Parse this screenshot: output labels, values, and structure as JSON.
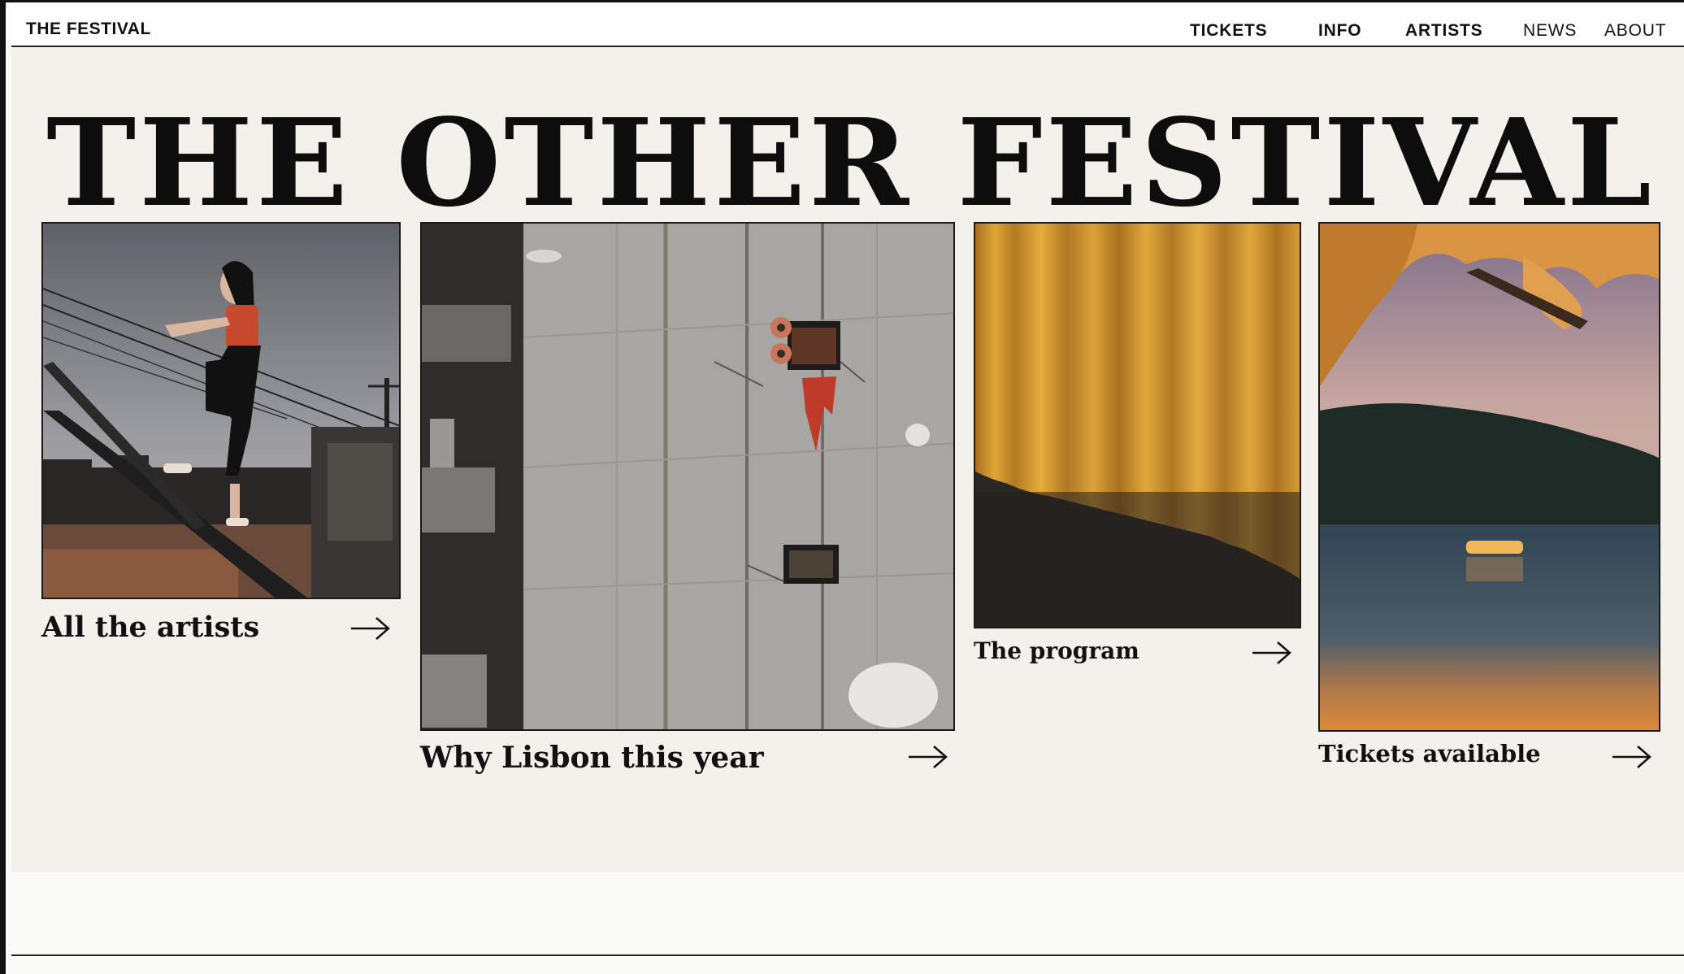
{
  "nav": {
    "brand": "THE FESTIVAL",
    "links": [
      {
        "label": "TICKETS",
        "bold": true
      },
      {
        "label": "INFO",
        "bold": true
      },
      {
        "label": "ARTISTS",
        "bold": true
      },
      {
        "label": "NEWS",
        "bold": false
      },
      {
        "label": "ABOUT",
        "bold": false
      }
    ]
  },
  "hero": {
    "title": "THE OTHER FESTIVAL"
  },
  "cards": [
    {
      "label": "All the artists",
      "image": "artist-photo",
      "arrow_icon": "arrow-right-icon"
    },
    {
      "label": "Why Lisbon this year",
      "image": "building-wall-photo",
      "arrow_icon": "arrow-right-icon"
    },
    {
      "label": "The program",
      "image": "curtain-photo",
      "arrow_icon": "arrow-right-icon"
    },
    {
      "label": "Tickets available",
      "image": "lake-photo",
      "arrow_icon": "arrow-right-icon"
    }
  ],
  "colors": {
    "background": "#f4f1ec",
    "text": "#0d0d0d",
    "curtain": "#d89a2b",
    "accent_red": "#c84a2e"
  }
}
